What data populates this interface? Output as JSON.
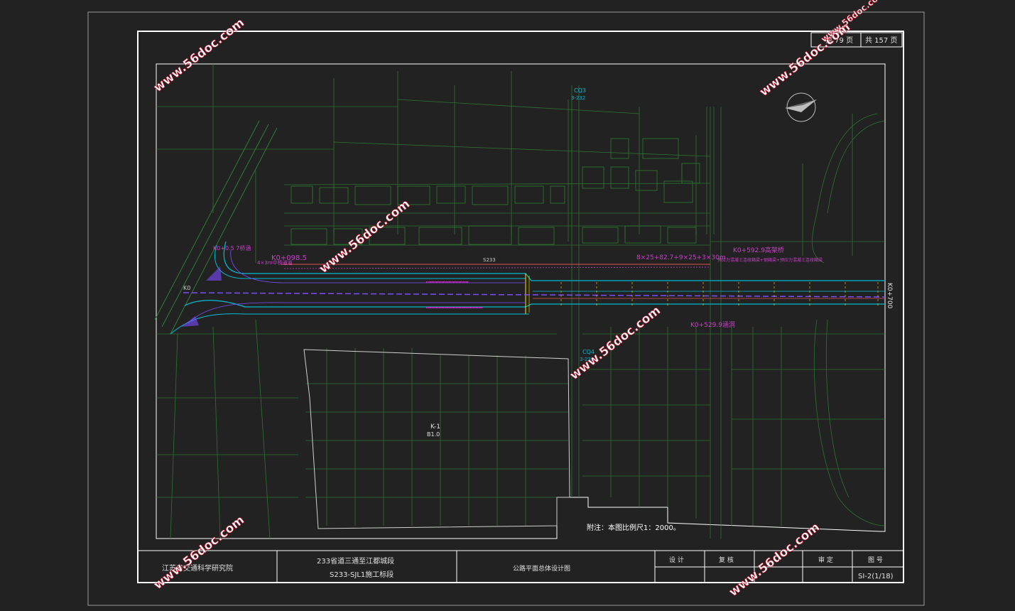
{
  "sheet": {
    "page_label": "第 79 页",
    "total_label": "共 157 页"
  },
  "title_block": {
    "org": "江苏省交通科学研究院",
    "project_line1": "233省道三通至江都城段",
    "project_line2": "S233-SJL1施工标段",
    "drawing_title": "公路平面总体设计图",
    "design_label": "设 计",
    "check_label": "复 核",
    "review_label": "审 定",
    "drawing_no_label": "图 号",
    "drawing_no": "SI-2(1/18)"
  },
  "annotations": {
    "note": "附注：本图比例尺1：2000。",
    "k0_label": "K0",
    "k0_end": "K0+700",
    "k0_098": "K0+098.5",
    "k0_098_desc": "4×3m中桥通道",
    "k0_top_left": "K0+0.5 7桥涵",
    "k0_592": "K0+592.9高架桥",
    "k0_529": "K0+529.9涵洞",
    "bridge_desc": "8×25+82.7+9×25+3×30m",
    "bridge_desc2": "预应力混凝土连续箱梁+钢箱梁+预应力混凝土连续箱梁",
    "cq3": "CQ3",
    "cq3_sub": "3-232",
    "cq4": "CQ4",
    "cq4_sub": "3-232",
    "k1": "K-1",
    "k1_sub": "B1.0",
    "road_label": "S233"
  },
  "watermarks": [
    "www.56doc.com",
    "www.56doc.com",
    "www.56doc.com",
    "www.56doc.com",
    "www.56doc.com",
    "www.56doc.com",
    "www.56doc.com"
  ],
  "colors": {
    "background": "#222222",
    "frame": "#ffffff",
    "terrain": "#2e7d32",
    "road_edge": "#00bcd4",
    "centerline": "#7c4dff",
    "annotation": "#c840c8",
    "watermark": "#d0112b"
  }
}
